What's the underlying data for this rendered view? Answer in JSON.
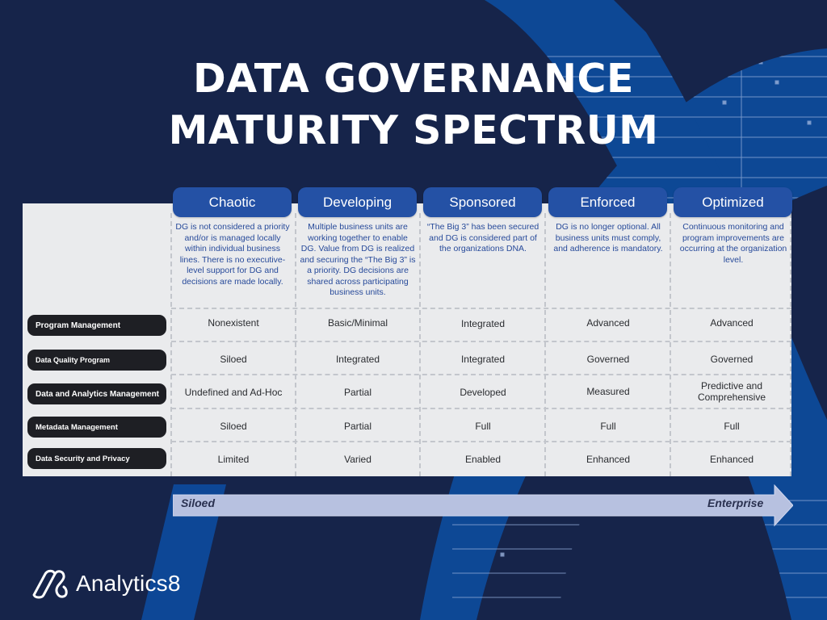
{
  "title": {
    "line1": "DATA GOVERNANCE",
    "line2": "MATURITY SPECTRUM"
  },
  "stages": [
    {
      "name": "Chaotic",
      "description": "DG is not considered a priority and/or is managed locally within individual business lines. There is no executive-level support for DG and decisions are made locally."
    },
    {
      "name": "Developing",
      "description": "Multiple business units are working together to enable DG. Value from DG is realized and securing the “The Big 3” is a priority. DG decisions are shared across participating business units."
    },
    {
      "name": "Sponsored",
      "description": "“The Big 3” has been secured and DG is considered part of the organizations DNA."
    },
    {
      "name": "Enforced",
      "description": "DG is no longer optional. All business units must comply, and adherence is mandatory."
    },
    {
      "name": "Optimized",
      "description": "Continuous monitoring and program improvements are occurring at the organization level."
    }
  ],
  "rows": [
    {
      "label": "Program Management",
      "values": [
        "Nonexistent",
        "Basic/Minimal",
        "Integrated",
        "Advanced",
        "Advanced"
      ]
    },
    {
      "label": "Data Quality Program",
      "values": [
        "Siloed",
        "Integrated",
        "Integrated",
        "Governed",
        "Governed"
      ]
    },
    {
      "label": "Data and Analytics Management",
      "values": [
        "Undefined and Ad-Hoc",
        "Partial",
        "Developed",
        "Measured",
        "Predictive and Comprehensive"
      ]
    },
    {
      "label": "Metadata Management",
      "values": [
        "Siloed",
        "Partial",
        "Full",
        "Full",
        "Full"
      ]
    },
    {
      "label": "Data Security and Privacy",
      "values": [
        "Limited",
        "Varied",
        "Enabled",
        "Enhanced",
        "Enhanced"
      ]
    }
  ],
  "spectrum": {
    "start": "Siloed",
    "end": "Enterprise"
  },
  "brand": {
    "name": "Analytics8",
    "logo_icon": "analytics8-logo-icon"
  },
  "colors": {
    "background": "#16244a",
    "accent_blue": "#2451a5",
    "panel": "#eaebed",
    "row_label": "#1e1f24",
    "arrow": "#b7c1e0"
  }
}
